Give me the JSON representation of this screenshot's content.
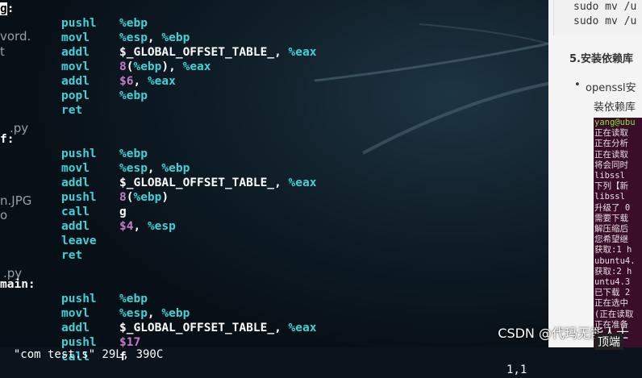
{
  "editor": {
    "blocks": [
      {
        "label": "g:",
        "lines": [
          [
            "pushl",
            [
              [
                "%ebp",
                "reg"
              ]
            ]
          ],
          [
            "movl",
            [
              [
                "%esp",
                "reg"
              ],
              [
                ", ",
                "plain"
              ],
              [
                "%ebp",
                "reg"
              ]
            ]
          ],
          [
            "addl",
            [
              [
                "$_GLOBAL_OFFSET_TABLE_",
                "sym"
              ],
              [
                ", ",
                "plain"
              ],
              [
                "%eax",
                "reg"
              ]
            ]
          ],
          [
            "movl",
            [
              [
                "8",
                "num"
              ],
              [
                "(",
                "plain"
              ],
              [
                "%ebp",
                "reg"
              ],
              [
                "), ",
                "plain"
              ],
              [
                "%eax",
                "reg"
              ]
            ]
          ],
          [
            "addl",
            [
              [
                "$6",
                "num"
              ],
              [
                ", ",
                "plain"
              ],
              [
                "%eax",
                "reg"
              ]
            ]
          ],
          [
            "popl",
            [
              [
                "%ebp",
                "reg"
              ]
            ]
          ],
          [
            "ret",
            []
          ]
        ]
      },
      {
        "label": "f:",
        "lines": [
          [
            "pushl",
            [
              [
                "%ebp",
                "reg"
              ]
            ]
          ],
          [
            "movl",
            [
              [
                "%esp",
                "reg"
              ],
              [
                ", ",
                "plain"
              ],
              [
                "%ebp",
                "reg"
              ]
            ]
          ],
          [
            "addl",
            [
              [
                "$_GLOBAL_OFFSET_TABLE_",
                "sym"
              ],
              [
                ", ",
                "plain"
              ],
              [
                "%eax",
                "reg"
              ]
            ]
          ],
          [
            "pushl",
            [
              [
                "8",
                "num"
              ],
              [
                "(",
                "plain"
              ],
              [
                "%ebp",
                "reg"
              ],
              [
                ")",
                "plain"
              ]
            ]
          ],
          [
            "call",
            [
              [
                "g",
                "sym"
              ]
            ]
          ],
          [
            "addl",
            [
              [
                "$4",
                "num"
              ],
              [
                ", ",
                "plain"
              ],
              [
                "%esp",
                "reg"
              ]
            ]
          ],
          [
            "leave",
            []
          ],
          [
            "ret",
            []
          ]
        ]
      },
      {
        "label": "main:",
        "lines": [
          [
            "pushl",
            [
              [
                "%ebp",
                "reg"
              ]
            ]
          ],
          [
            "movl",
            [
              [
                "%esp",
                "reg"
              ],
              [
                ", ",
                "plain"
              ],
              [
                "%ebp",
                "reg"
              ]
            ]
          ],
          [
            "addl",
            [
              [
                "$_GLOBAL_OFFSET_TABLE_",
                "sym"
              ],
              [
                ", ",
                "plain"
              ],
              [
                "%eax",
                "reg"
              ]
            ]
          ],
          [
            "pushl",
            [
              [
                "$17",
                "num"
              ]
            ]
          ],
          [
            "call",
            [
              [
                "f",
                "sym"
              ]
            ]
          ]
        ]
      }
    ],
    "status_file": "\"com test.s\" 29L, 390C",
    "status_pos": "1,1"
  },
  "desktop_fragments": [
    "e",
    "vord.",
    "t",
    ".py",
    "n.JPG",
    "o",
    ".py"
  ],
  "browser": {
    "code_lines": [
      "sudo mv /u",
      "sudo mv /u"
    ],
    "heading": "5.安装依赖库",
    "bullet": "openssl安",
    "sub": "装依赖库",
    "terminal_lines": [
      "yang@ubu",
      "正在读取",
      "正在分析",
      "正在读取",
      "将会同时",
      "  libssl",
      "下列【新",
      "  libssl",
      "升级了 0",
      "需要下载",
      "解压缩后",
      "您希望继",
      "获取:1 h",
      "ubuntu4.",
      "获取:2 h",
      "untu4.3",
      "已下载 2",
      "正在选中",
      "(正在读取",
      "正在准备"
    ]
  },
  "watermark": "CSDN @代玛无能人士",
  "vim_position_right": "顶端",
  "colors": {
    "instr": "#40d2d6",
    "register": "#40d2d6",
    "number": "#c77ac7",
    "label": "#ffffff",
    "terminal_bg": "#3a0d29"
  }
}
